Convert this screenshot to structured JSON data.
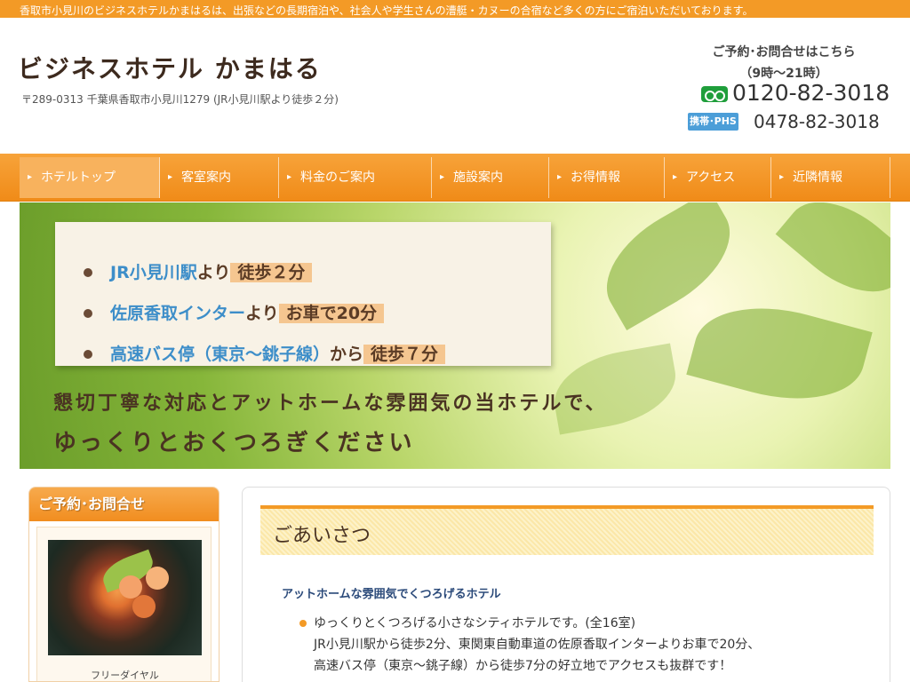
{
  "top_bar": {
    "text": "香取市小見川のビジネスホテルかまはるは、出張などの長期宿泊や、社会人や学生さんの漕艇・カヌーの合宿など多くの方にご宿泊いただいております。"
  },
  "header": {
    "title": "ビジネスホテル かまはる",
    "address": "〒289-0313 千葉県香取市小見川1279 (JR小見川駅より徒歩２分)",
    "contact_heading": "ご予約･お問合せはこちら",
    "contact_hours": "（9時～21時）",
    "free_dial_number": "0120-82-3018",
    "mobile_badge": "携帯･PHS",
    "mobile_number": "0478-82-3018"
  },
  "nav": {
    "items": [
      {
        "label": "ホテルトップ",
        "active": true
      },
      {
        "label": "客室案内"
      },
      {
        "label": "料金のご案内"
      },
      {
        "label": "施設案内"
      },
      {
        "label": "お得情報"
      },
      {
        "label": "アクセス"
      },
      {
        "label": "近隣情報"
      }
    ]
  },
  "hero": {
    "lines": [
      {
        "blue": "JR小見川駅",
        "brown": "より",
        "highlight": "徒歩２分"
      },
      {
        "blue": "佐原香取インター",
        "brown": "より",
        "highlight": "お車で20分"
      },
      {
        "blue": "高速バス停（東京～銚子線）",
        "brown": "から",
        "highlight": "徒歩７分"
      }
    ],
    "message_1": "懇切丁寧な対応とアットホームな雰囲気の当ホテルで、",
    "message_2": "ゆっくりとおくつろぎください"
  },
  "sidebar": {
    "heading": "ご予約･お問合せ",
    "free_label": "フリーダイヤル"
  },
  "main": {
    "heading": "ごあいさつ",
    "subheading": "アットホームな雰囲気でくつろげるホテル",
    "paragraph_lines": [
      "ゆっくりとくつろげる小さなシティホテルです。(全16室)",
      "JR小見川駅から徒歩2分、東関東自動車道の佐原香取インターよりお車で20分、",
      "高速バス停（東京～銚子線）から徒歩7分の好立地でアクセスも抜群です！"
    ]
  },
  "colors": {
    "accent": "#f39a26",
    "link_blue": "#3d8ec9",
    "brown": "#4a3322",
    "free_dial_green": "#1f9e3b"
  }
}
